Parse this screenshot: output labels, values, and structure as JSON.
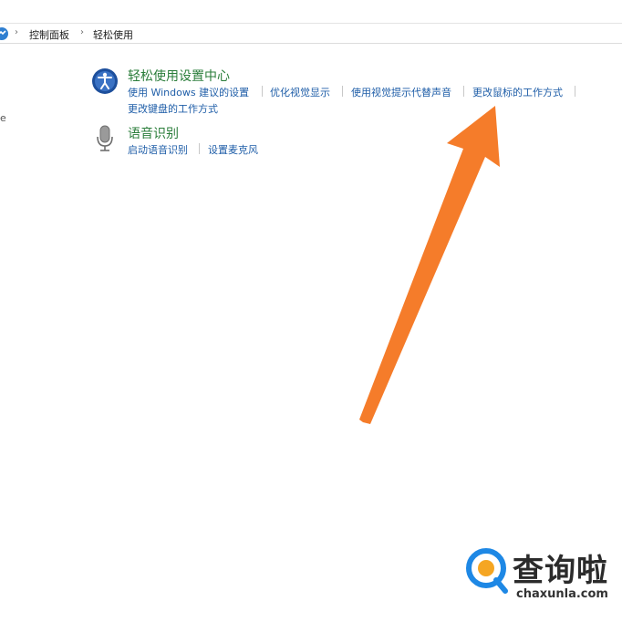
{
  "breadcrumb": {
    "items": [
      "控制面板",
      "轻松使用"
    ],
    "separator": "›"
  },
  "sections": [
    {
      "title": "轻松使用设置中心",
      "icon": "ease-of-access-icon",
      "links": [
        "使用 Windows 建议的设置",
        "优化视觉显示",
        "使用视觉提示代替声音",
        "更改鼠标的工作方式",
        "更改键盘的工作方式"
      ]
    },
    {
      "title": "语音识别",
      "icon": "microphone-icon",
      "links": [
        "启动语音识别",
        "设置麦克风"
      ]
    }
  ],
  "left_pane_fragment": "e",
  "annotation": {
    "type": "arrow",
    "color": "#f57c2a"
  },
  "watermark": {
    "brand": "查询啦",
    "url": "chaxunla.com",
    "logo_color": "#1e88e5",
    "logo_accent": "#f5a623"
  },
  "colors": {
    "link": "#1f5ea8",
    "category_title": "#2a7d3a"
  }
}
